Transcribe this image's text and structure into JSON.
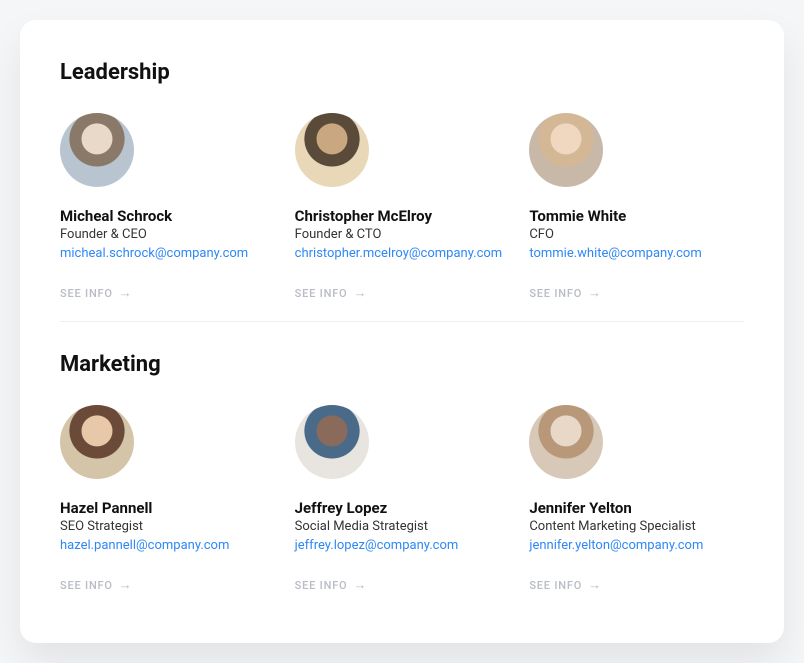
{
  "see_info_label": "SEE INFO",
  "arrow_glyph": "→",
  "sections": [
    {
      "title": "Leadership",
      "members": [
        {
          "name": "Micheal Schrock",
          "role": "Founder & CEO",
          "email": "micheal.schrock@company.com"
        },
        {
          "name": "Christopher McElroy",
          "role": "Founder & CTO",
          "email": "christopher.mcelroy@company.com"
        },
        {
          "name": "Tommie White",
          "role": "CFO",
          "email": "tommie.white@company.com"
        }
      ]
    },
    {
      "title": "Marketing",
      "members": [
        {
          "name": "Hazel Pannell",
          "role": "SEO Strategist",
          "email": "hazel.pannell@company.com"
        },
        {
          "name": "Jeffrey Lopez",
          "role": "Social Media Strategist",
          "email": "jeffrey.lopez@company.com"
        },
        {
          "name": "Jennifer Yelton",
          "role": "Content Marketing Specialist",
          "email": "jennifer.yelton@company.com"
        }
      ]
    }
  ]
}
